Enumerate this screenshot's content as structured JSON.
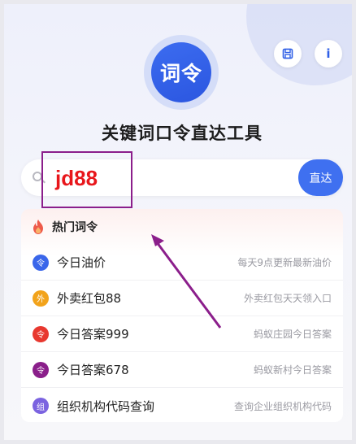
{
  "header": {
    "logo_text": "词令",
    "title": "关键词口令直达工具",
    "save_icon": "save-icon",
    "info_label": "i"
  },
  "search": {
    "value": "jd88",
    "go_label": "直达"
  },
  "hot": {
    "title": "热门词令",
    "items": [
      {
        "badge": "令",
        "name": "今日油价",
        "desc": "每天9点更新最新油价",
        "color": "#3a66ea"
      },
      {
        "badge": "外",
        "name": "外卖红包88",
        "desc": "外卖红包天天领入口",
        "color": "#f2a31b"
      },
      {
        "badge": "令",
        "name": "今日答案999",
        "desc": "蚂蚁庄园今日答案",
        "color": "#e8382f"
      },
      {
        "badge": "令",
        "name": "今日答案678",
        "desc": "蚂蚁新村今日答案",
        "color": "#8a1f8a"
      },
      {
        "badge": "组",
        "name": "组织机构代码查询",
        "desc": "查询企业组织机构代码",
        "color": "#7b63e0"
      }
    ]
  },
  "colors": {
    "accent": "#3f70f0",
    "annotation": "#8b1e8b",
    "search_text": "#e8161b"
  }
}
